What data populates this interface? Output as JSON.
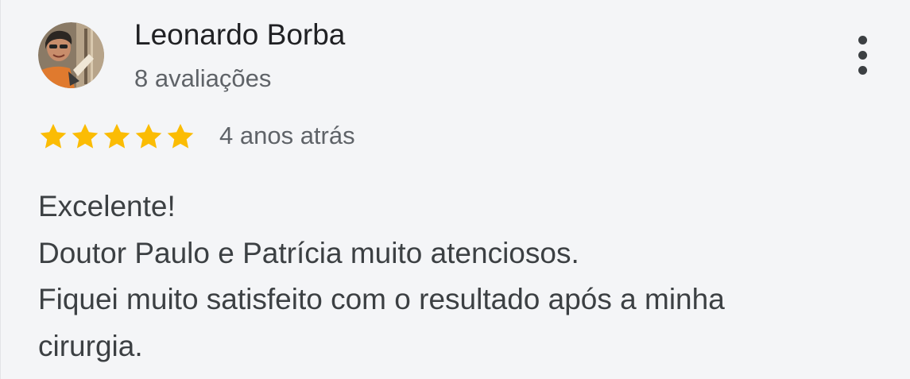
{
  "review": {
    "author": {
      "name": "Leonardo Borba",
      "review_count": "8 avaliações",
      "avatar_icon": "profile-photo"
    },
    "rating": 5,
    "rating_max": 5,
    "star_color": "#fbbc04",
    "time": "4 anos atrás",
    "text_lines": [
      "Excelente!",
      "Doutor Paulo e Patrícia muito atenciosos.",
      "Fiquei muito satisfeito com o resultado após a minha",
      "cirurgia."
    ],
    "more_options_icon": "more-vert-icon"
  }
}
